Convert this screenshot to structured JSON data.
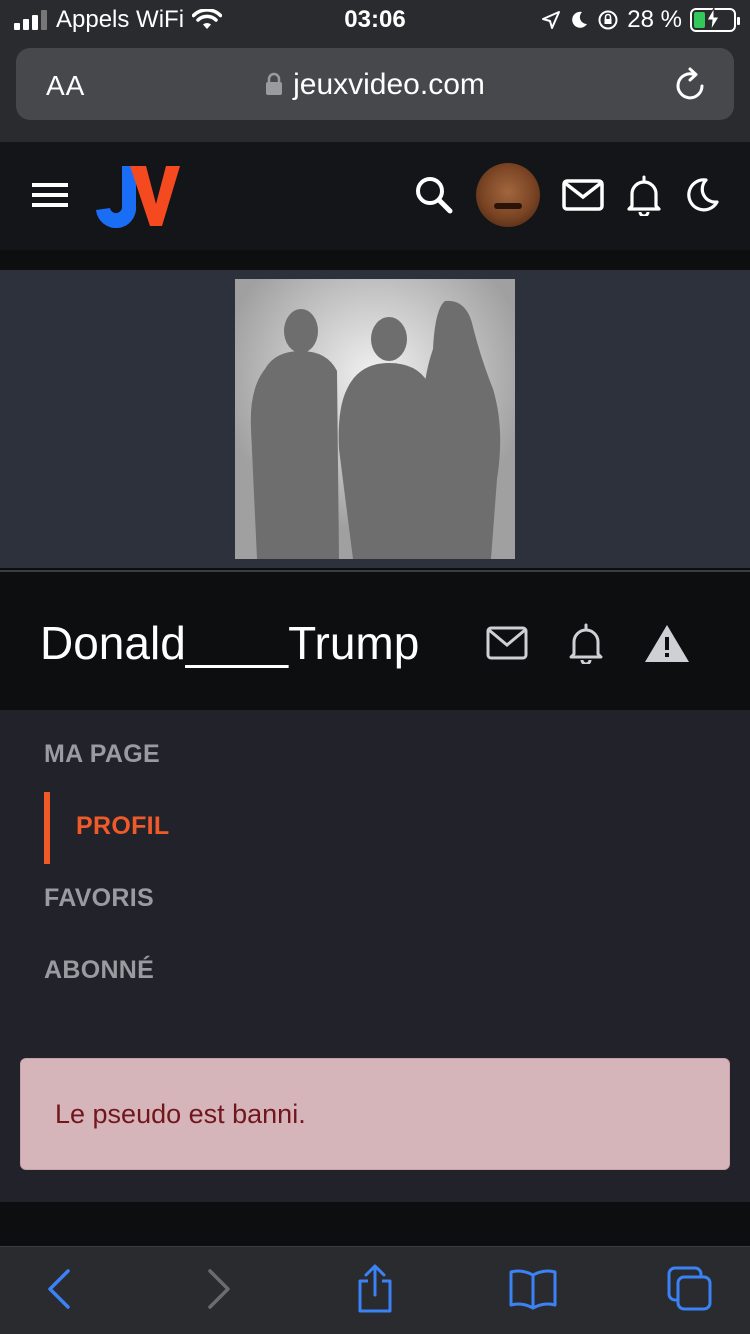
{
  "status_bar": {
    "carrier": "Appels WiFi",
    "time": "03:06",
    "battery": "28 %"
  },
  "browser": {
    "text_size_label": "AA",
    "url": "jeuxvideo.com"
  },
  "site_header": {
    "logo_text": "JV"
  },
  "profile": {
    "username": "Donald____Trump"
  },
  "nav": {
    "items": [
      {
        "label": "MA PAGE"
      },
      {
        "label": "PROFIL",
        "active": true
      },
      {
        "label": "FAVORIS"
      },
      {
        "label": "ABONNÉ"
      }
    ]
  },
  "alert": {
    "message": "Le pseudo est banni."
  },
  "colors": {
    "accent": "#f05a28",
    "logo_blue": "#1a6ef5",
    "alert_bg": "#d5b5ba",
    "alert_text": "#72161d",
    "safari_blue": "#3b82f6"
  }
}
